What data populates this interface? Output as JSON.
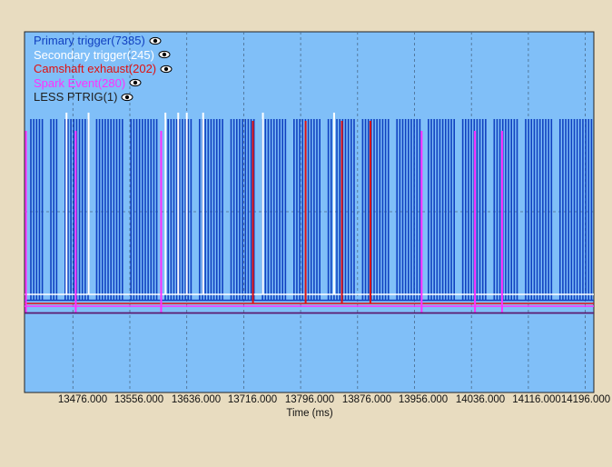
{
  "chart_data": {
    "type": "timing",
    "xlabel": "Time (ms)",
    "xlim": [
      13408,
      14208
    ],
    "x_ticks": [
      13476,
      13556,
      13636,
      13716,
      13796,
      13876,
      13956,
      14036,
      14116,
      14196
    ],
    "x_tick_labels": [
      "13476.000",
      "13556.000",
      "13636.000",
      "13716.000",
      "13796.000",
      "13876.000",
      "13956.000",
      "14036.000",
      "14116.000",
      "14196.000"
    ],
    "grid": true,
    "legend_position": "top-left",
    "colors": {
      "plot_background": "#80bff8",
      "grid": "#4a6a8a",
      "page_background": "#e8dcc0"
    },
    "series": [
      {
        "name": "Primary trigger(7385)",
        "color": "#1040c0"
      },
      {
        "name": "Secondary trigger(245)",
        "color": "#ffffff"
      },
      {
        "name": "Camshaft exhaust(202)",
        "color": "#e01010"
      },
      {
        "name": "Spark Event(280)",
        "color": "#ff30ff"
      },
      {
        "name": "LESS PTRIG(1)",
        "color": "#202020"
      }
    ],
    "secondary_trigger_times": [
      13467,
      13498,
      13606,
      13624,
      13636,
      13659,
      13743,
      13843
    ],
    "camshaft_exhaust_times": [
      13729,
      13803,
      13854,
      13894
    ],
    "spark_event_times": [
      13410,
      13480,
      13600,
      13966,
      14041,
      14079
    ],
    "primary_gap_times": [
      13439,
      13458,
      13503,
      13551,
      13600,
      13647,
      13691,
      13735,
      13780,
      13830,
      13876,
      13926,
      13971,
      14018,
      14063,
      14108,
      14155
    ]
  }
}
